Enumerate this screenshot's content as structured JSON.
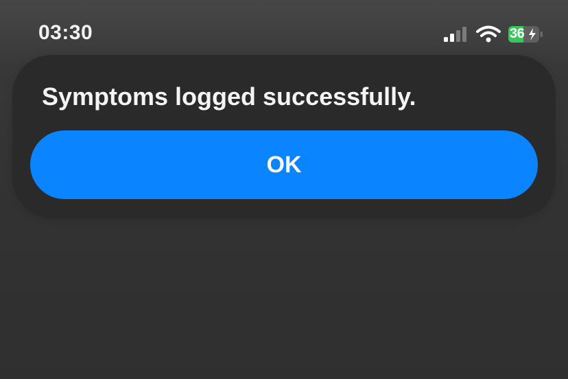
{
  "status_bar": {
    "time": "03:30",
    "battery_level": "36",
    "battery_charging": true,
    "icons": [
      "signal-icon",
      "wifi-icon",
      "battery-charging-icon"
    ],
    "colors": {
      "battery_fill": "#34c759"
    }
  },
  "alert": {
    "message": "Symptoms logged successfully.",
    "ok_label": "OK"
  },
  "colors": {
    "accent": "#0a84ff",
    "card_background": "#2a2a2a"
  }
}
